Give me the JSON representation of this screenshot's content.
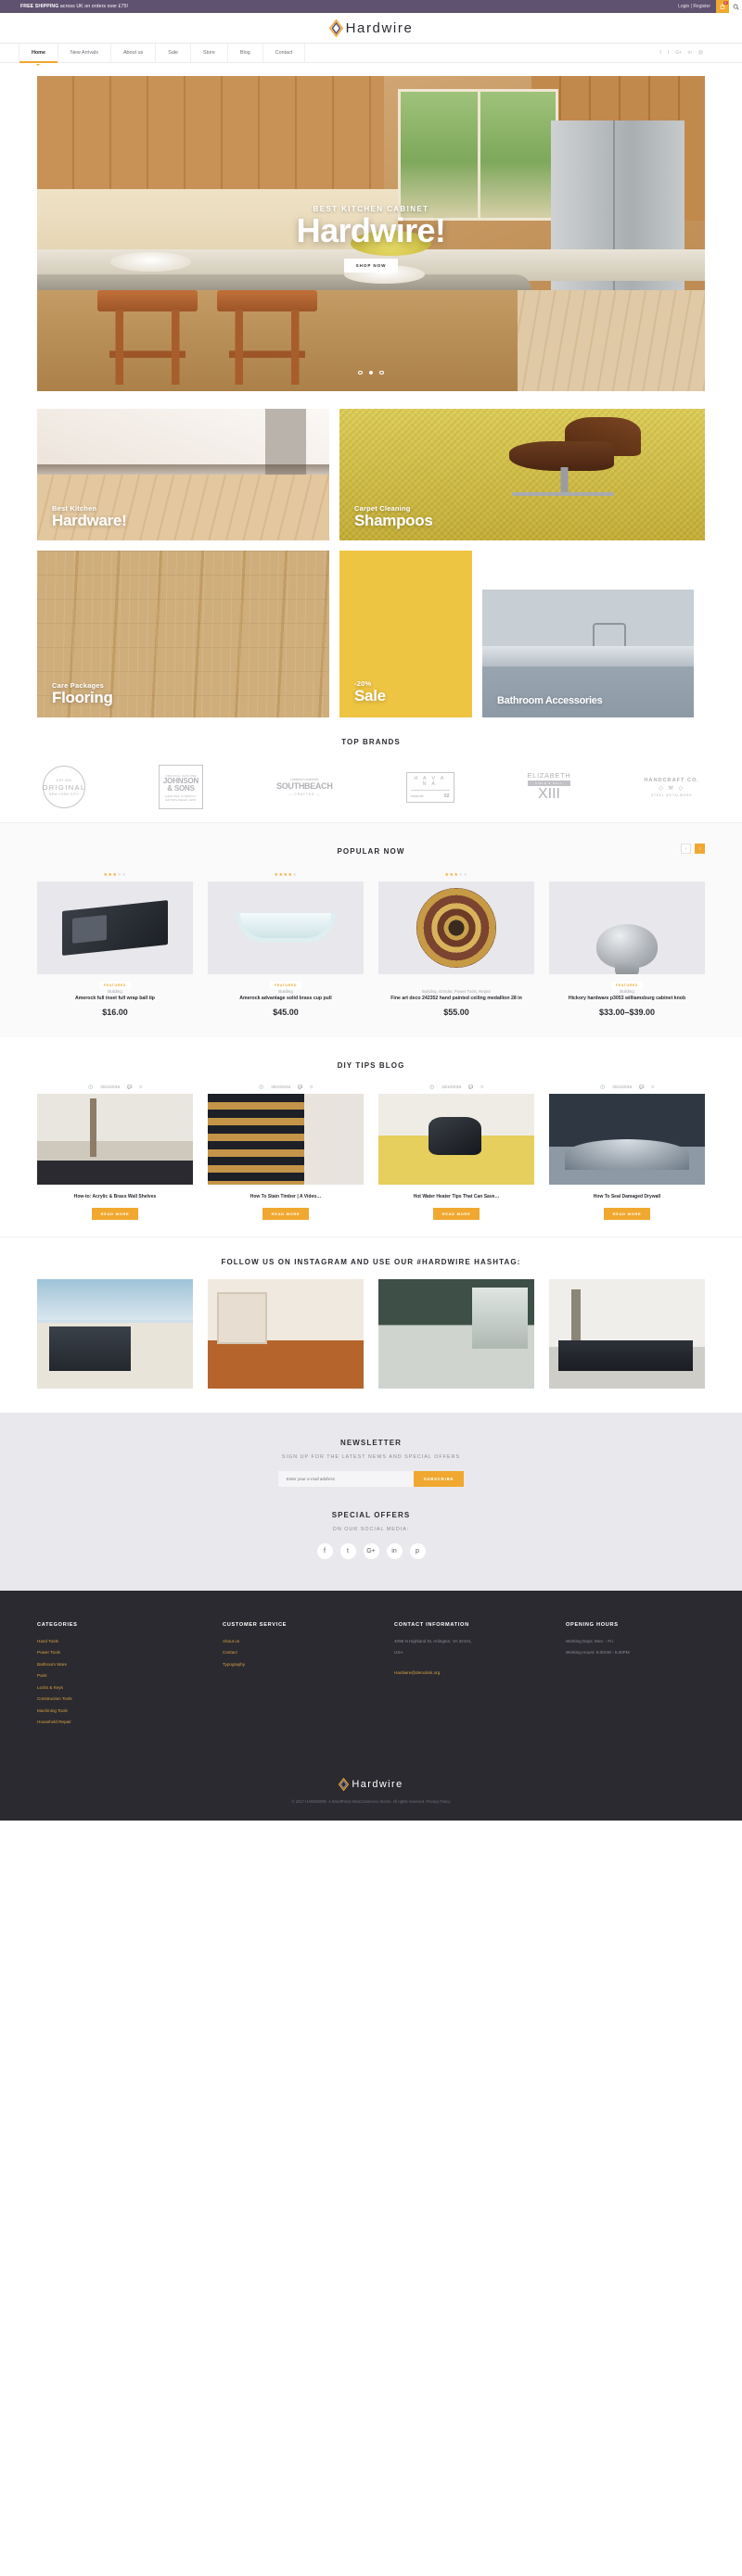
{
  "topbar": {
    "promo_bold": "FREE SHIPPING",
    "promo_rest": " across UK on orders over £75!",
    "account": "Login | Register",
    "cart_count": "0",
    "cart_icon": "shopping-cart-icon",
    "search_icon": "search-icon"
  },
  "brand": {
    "name": "Hardwire",
    "logo_icon": "diamond-logo-icon"
  },
  "nav": {
    "items": [
      {
        "label": "Home",
        "active": true
      },
      {
        "label": "New Arrivals",
        "active": false
      },
      {
        "label": "About us",
        "active": false
      },
      {
        "label": "Sale",
        "active": false
      },
      {
        "label": "Store",
        "active": false
      },
      {
        "label": "Blog",
        "active": false
      },
      {
        "label": "Contact",
        "active": false
      }
    ],
    "social": [
      "f",
      "t",
      "G+",
      "in",
      "@"
    ]
  },
  "hero": {
    "subtitle": "BEST KITCHEN CABINET",
    "title": "Hardwire!",
    "button": "SHOP NOW",
    "slide_count": 3,
    "active_slide": 2
  },
  "tiles": [
    {
      "small": "Best Kitchen",
      "big": "Hardware!"
    },
    {
      "small": "Carpet Cleaning",
      "big": "Shampoos"
    },
    {
      "small": "Care Packages",
      "big": "Flooring"
    },
    {
      "small": "-20%",
      "big": "Sale"
    },
    {
      "small": "",
      "big": "Bathroom Accessories"
    }
  ],
  "brands": {
    "title": "TOP BRANDS",
    "items": [
      {
        "name": "326 ORIGINAL",
        "top": "EST 326",
        "main": "ORIGINAL",
        "bottom": "NEW YORK CITY"
      },
      {
        "name": "Johnson & Sons",
        "tag": "ORIGINAL GENUINE",
        "l1": "JOHNSON",
        "l2": "& SONS",
        "sub": "GENUINE COMPANY ESTABLISHED 1988"
      },
      {
        "name": "Southbeach Crafted",
        "script": "Lastbeach Authentic",
        "main": "SOUTHBEACH",
        "sub": "— CRAFTED —"
      },
      {
        "name": "Havana Handcraft 02",
        "main": "H A V A N A",
        "script": "Handcraft",
        "series": "SERIES",
        "num": "02"
      },
      {
        "name": "Elizabeth",
        "main": "ELIZABETH",
        "ribbon": "FIELD & HALL",
        "sub": "XIII"
      },
      {
        "name": "Handcraft Co.",
        "main": "HANDCRAFT CO.",
        "sub": "STEEL METALWORK"
      }
    ]
  },
  "popular": {
    "title": "POPULAR NOW",
    "prev_icon": "chevron-left-icon",
    "next_icon": "chevron-right-icon",
    "products": [
      {
        "rating": 3,
        "rating_max": 5,
        "badge": "FEATURED",
        "category": "Building",
        "name": "Amerock full inset full wrap ball tip",
        "price": "$16.00"
      },
      {
        "rating": 4,
        "rating_max": 5,
        "badge": "FEATURED",
        "category": "Building",
        "name": "Amerock advantage solid brass cup pull",
        "price": "$45.00"
      },
      {
        "rating": 3,
        "rating_max": 5,
        "badge": "",
        "category": "Building, Grinder, Power Tools, Repair",
        "name": "Fine art deco 242352 hand painted ceiling medallion 28 in",
        "price": "$55.00"
      },
      {
        "rating": 0,
        "rating_max": 5,
        "badge": "FEATURED",
        "category": "Building",
        "name": "Hickory hardware p3053 williamsburg cabinet knob",
        "price": "$33.00–$39.00"
      }
    ]
  },
  "blog": {
    "title": "DIY TIPS BLOG",
    "posts": [
      {
        "date": "25/10/2016",
        "comments": "0",
        "title": "How-to: Acrylic & Brass Wall Shelves",
        "button": "READ MORE"
      },
      {
        "date": "25/10/2016",
        "comments": "0",
        "title": "How To Stain Timber | A Video…",
        "button": "READ MORE"
      },
      {
        "date": "25/10/2016",
        "comments": "0",
        "title": "Hot Water Heater Tips That Can Save…",
        "button": "READ MORE"
      },
      {
        "date": "25/10/2016",
        "comments": "0",
        "title": "How To Seal Damaged Drywall",
        "button": "READ MORE"
      }
    ]
  },
  "instagram": {
    "title": "FOLLOW US ON INSTAGRAM AND USE OUR #HARDWIRE HASHTAG:"
  },
  "newsletter": {
    "title": "NEWSLETTER",
    "subtitle": "SIGN UP FOR THE LATEST NEWS AND SPECIAL OFFERS",
    "placeholder": "Enter your e-mail address",
    "button": "SUBSCRIBE",
    "offers_title": "SPECIAL OFFERS",
    "offers_subtitle": "ON OUR SOCIAL MEDIA:",
    "social": [
      "f",
      "t",
      "G+",
      "in",
      "p"
    ]
  },
  "footer": {
    "categories": {
      "title": "CATEGORIES",
      "links": [
        "Hand Tools",
        "Power Tools",
        "Bathroom Ware",
        "Paint",
        "Locks & Keys",
        "Construction Tools",
        "Machining Tools",
        "Household Repair"
      ]
    },
    "customer_service": {
      "title": "CUSTOMER SERVICE",
      "links": [
        "About us",
        "Contact",
        "Typography"
      ]
    },
    "contact": {
      "title": "CONTACT INFORMATION",
      "address1": "4096 N Highland St, Arlington, VA 32101,",
      "address2": "USA",
      "email": "Hardwire@demolink.org"
    },
    "hours": {
      "title": "OPENING HOURS",
      "days": "Working Days: Mon. - Fri.",
      "time": "Working Hours: 9.00AM - 5.00PM"
    },
    "logo_text": "Hardwire",
    "copyright": "© 2017 HARDWIRE. A WordPress WooCommerce theme. All rights reserved. Privacy Policy"
  },
  "colors": {
    "accent": "#f0a830",
    "topbar": "#5f5270",
    "footer": "#2b2a30",
    "newsletter_bg": "#e9e8ec"
  }
}
